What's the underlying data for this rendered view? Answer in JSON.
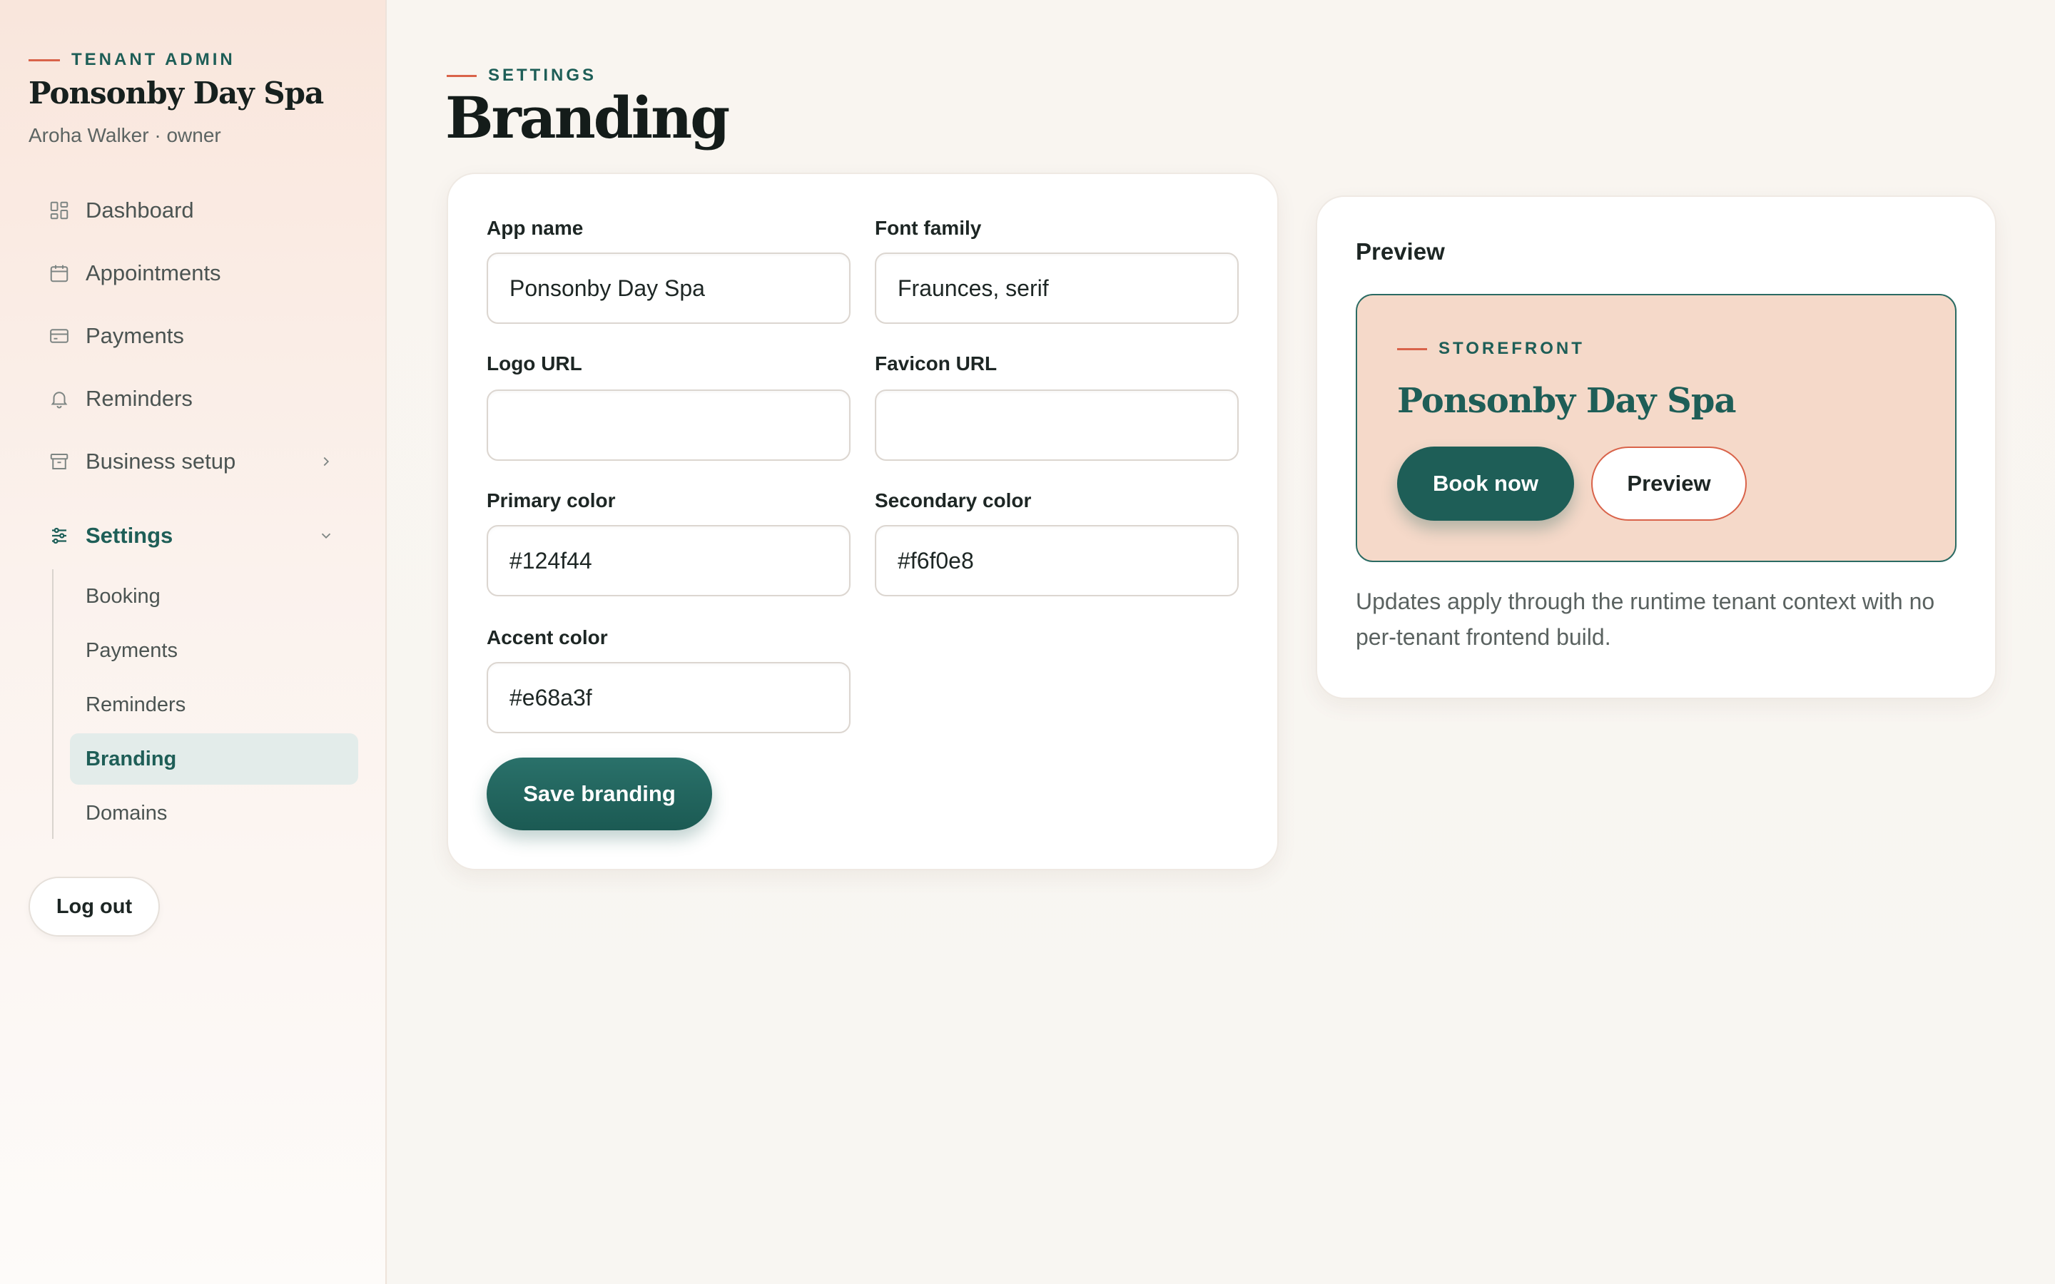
{
  "sidebar": {
    "eyebrow": "TENANT ADMIN",
    "business_name": "Ponsonby Day Spa",
    "user": "Aroha Walker · owner",
    "nav": {
      "dashboard": "Dashboard",
      "appointments": "Appointments",
      "payments": "Payments",
      "reminders": "Reminders",
      "business_setup": "Business setup",
      "settings": "Settings"
    },
    "settings_sub": {
      "booking": "Booking",
      "payments": "Payments",
      "reminders": "Reminders",
      "branding": "Branding",
      "domains": "Domains"
    },
    "logout": "Log out"
  },
  "page": {
    "eyebrow": "SETTINGS",
    "title": "Branding"
  },
  "form": {
    "app_name": {
      "label": "App name",
      "value": "Ponsonby Day Spa"
    },
    "font_family": {
      "label": "Font family",
      "value": "Fraunces, serif"
    },
    "logo_url": {
      "label": "Logo URL",
      "value": ""
    },
    "favicon_url": {
      "label": "Favicon URL",
      "value": ""
    },
    "primary_color": {
      "label": "Primary color",
      "value": "#124f44"
    },
    "secondary_color": {
      "label": "Secondary color",
      "value": "#f6f0e8"
    },
    "accent_color": {
      "label": "Accent color",
      "value": "#e68a3f"
    },
    "save_label": "Save branding"
  },
  "preview": {
    "heading": "Preview",
    "eyebrow": "STOREFRONT",
    "title": "Ponsonby Day Spa",
    "book_label": "Book now",
    "preview_label": "Preview",
    "note": "Updates apply through the runtime tenant context with no per-tenant frontend build."
  },
  "colors": {
    "brand_teal": "#1e5e57",
    "accent_coral": "#d9634a",
    "storefront_bg": "#f5d9c9",
    "active_nav_bg": "#e3ecea"
  }
}
